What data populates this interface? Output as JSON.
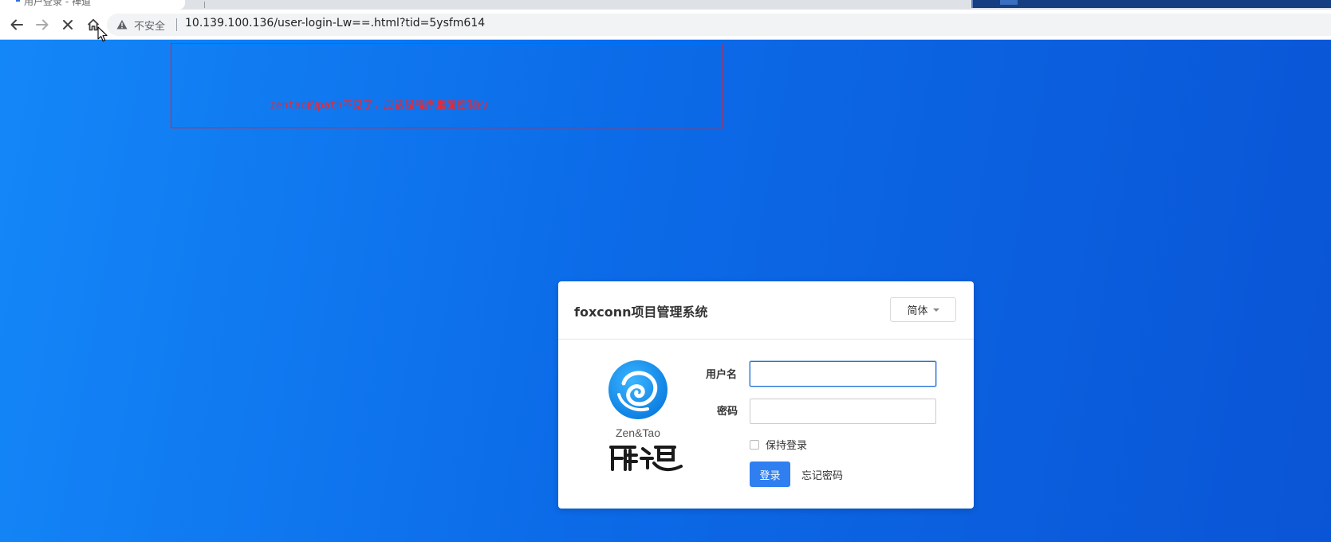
{
  "browser": {
    "tab_title": "用户登录 - 禅道",
    "security_label": "不安全",
    "url": "10.139.100.136/user-login-Lw==.html?tid=5ysfm614"
  },
  "annotation": {
    "text": "zentao的path不见了，应该是程序里面控制的",
    "color": "#ff2020"
  },
  "login": {
    "title": "foxconn项目管理系统",
    "language": "简体",
    "logo_text": "Zen&Tao",
    "logo_name": "禅道",
    "username_label": "用户名",
    "password_label": "密码",
    "keep_login_label": "保持登录",
    "submit_label": "登录",
    "forgot_label": "忘记密码"
  },
  "colors": {
    "page_bg_start": "#1487f8",
    "page_bg_end": "#0a55d6",
    "primary_button": "#2f7ff0"
  },
  "icons": {
    "back": "arrow-left-icon",
    "forward": "arrow-right-icon",
    "stop": "close-icon",
    "home": "home-icon",
    "warning": "warning-triangle-icon",
    "language": "caret-down-icon"
  }
}
